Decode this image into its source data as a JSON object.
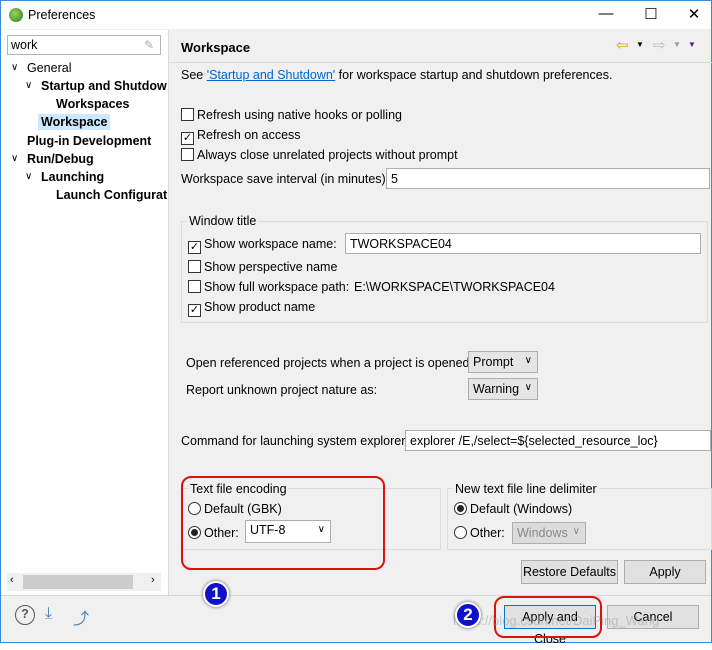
{
  "window": {
    "title": "Preferences",
    "icon": "eclipse-icon"
  },
  "sidebar": {
    "search_value": "work",
    "tree": [
      {
        "label": "General",
        "expanded": true
      },
      {
        "label": "Startup and Shutdow",
        "expanded": true
      },
      {
        "label": "Workspaces"
      },
      {
        "label": "Workspace",
        "selected": true
      },
      {
        "label": "Plug-in Development"
      },
      {
        "label": "Run/Debug",
        "expanded": true
      },
      {
        "label": "Launching",
        "expanded": true
      },
      {
        "label": "Launch Configurat"
      }
    ]
  },
  "page": {
    "title": "Workspace",
    "see_prefix": "See ",
    "see_link": "'Startup and Shutdown'",
    "see_suffix": " for workspace startup and shutdown preferences.",
    "options": [
      {
        "label": "Refresh using native hooks or polling",
        "checked": false
      },
      {
        "label": "Refresh on access",
        "checked": true
      },
      {
        "label": "Always close unrelated projects without prompt",
        "checked": false
      }
    ],
    "save_interval_label": "Workspace save interval (in minutes):",
    "save_interval_value": "5",
    "window_title": {
      "label": "Window title",
      "show_ws_name": "Show workspace name:",
      "ws_name_value": "TWORKSPACE04",
      "show_perspective": "Show perspective name",
      "show_full_path": "Show full workspace path:",
      "full_path_value": "E:\\WORKSPACE\\TWORKSPACE04",
      "show_product": "Show product name"
    },
    "open_ref_label": "Open referenced projects when a project is opened:",
    "open_ref_value": "Prompt",
    "unknown_nature_label": "Report unknown project nature as:",
    "unknown_nature_value": "Warning",
    "explorer_label": "Command for launching system explorer:",
    "explorer_value": "explorer /E,/select=${selected_resource_loc}",
    "encoding": {
      "label": "Text file encoding",
      "default": "Default (GBK)",
      "other": "Other:",
      "other_value": "UTF-8",
      "selected": "other"
    },
    "delimiter": {
      "label": "New text file line delimiter",
      "default": "Default (Windows)",
      "other": "Other:",
      "other_value": "Windows",
      "selected": "default"
    },
    "restore_defaults": "Restore Defaults",
    "apply": "Apply"
  },
  "footer": {
    "apply_close": "Apply and Close",
    "cancel": "Cancel"
  },
  "annotations": {
    "one": "1",
    "two": "2",
    "color": "#e01010"
  },
  "watermark": "https://blog.csdn.net/DaiPing_Wang"
}
